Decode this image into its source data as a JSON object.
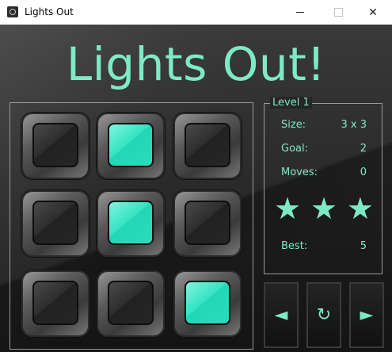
{
  "window": {
    "title": "Lights Out",
    "minimize_glyph": "",
    "maximize_glyph": "",
    "close_glyph": "✕"
  },
  "game": {
    "title": "Lights Out!",
    "board": {
      "rows": 3,
      "cols": 3,
      "cells": [
        [
          false,
          true,
          false
        ],
        [
          false,
          true,
          false
        ],
        [
          false,
          false,
          true
        ]
      ]
    },
    "level": {
      "legend": "Level 1",
      "size_label": "Size:",
      "size_value": "3 x 3",
      "goal_label": "Goal:",
      "goal_value": "2",
      "moves_label": "Moves:",
      "moves_value": "0",
      "stars": [
        "★",
        "★",
        "★"
      ],
      "best_label": "Best:",
      "best_value": "5"
    },
    "nav": {
      "prev_icon": "◄",
      "reset_icon": "↻",
      "next_icon": "►"
    }
  },
  "colors": {
    "accent": "#7ee9c6",
    "light_on": "#33e3c3",
    "light_off": "#2d2d2d"
  }
}
